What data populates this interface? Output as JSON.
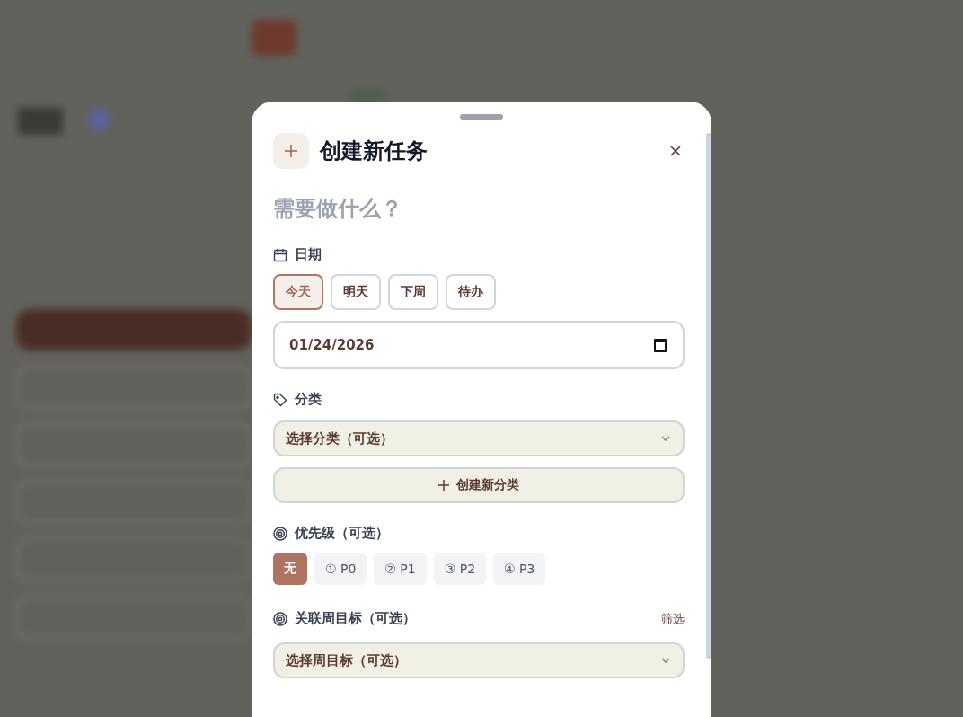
{
  "dialog": {
    "title": "创建新任务",
    "task_field": {
      "placeholder": "需要做什么？"
    },
    "date_section": {
      "label": "日期",
      "options": [
        {
          "label": "今天",
          "selected": true
        },
        {
          "label": "明天",
          "selected": false
        },
        {
          "label": "下周",
          "selected": false
        },
        {
          "label": "待办",
          "selected": false
        }
      ],
      "date_value": "01/24/2026"
    },
    "category_section": {
      "label": "分类",
      "select_placeholder": "选择分类（可选）",
      "create_button": "创建新分类"
    },
    "priority_section": {
      "label": "优先级（可选）",
      "options": [
        {
          "label": "无",
          "selected": true
        },
        {
          "label": "① P0",
          "selected": false
        },
        {
          "label": "② P1",
          "selected": false
        },
        {
          "label": "③ P2",
          "selected": false
        },
        {
          "label": "④ P3",
          "selected": false
        }
      ]
    },
    "goal_section": {
      "label": "关联周目标（可选）",
      "filter_link": "筛选",
      "select_placeholder": "选择周目标（可选）"
    }
  }
}
